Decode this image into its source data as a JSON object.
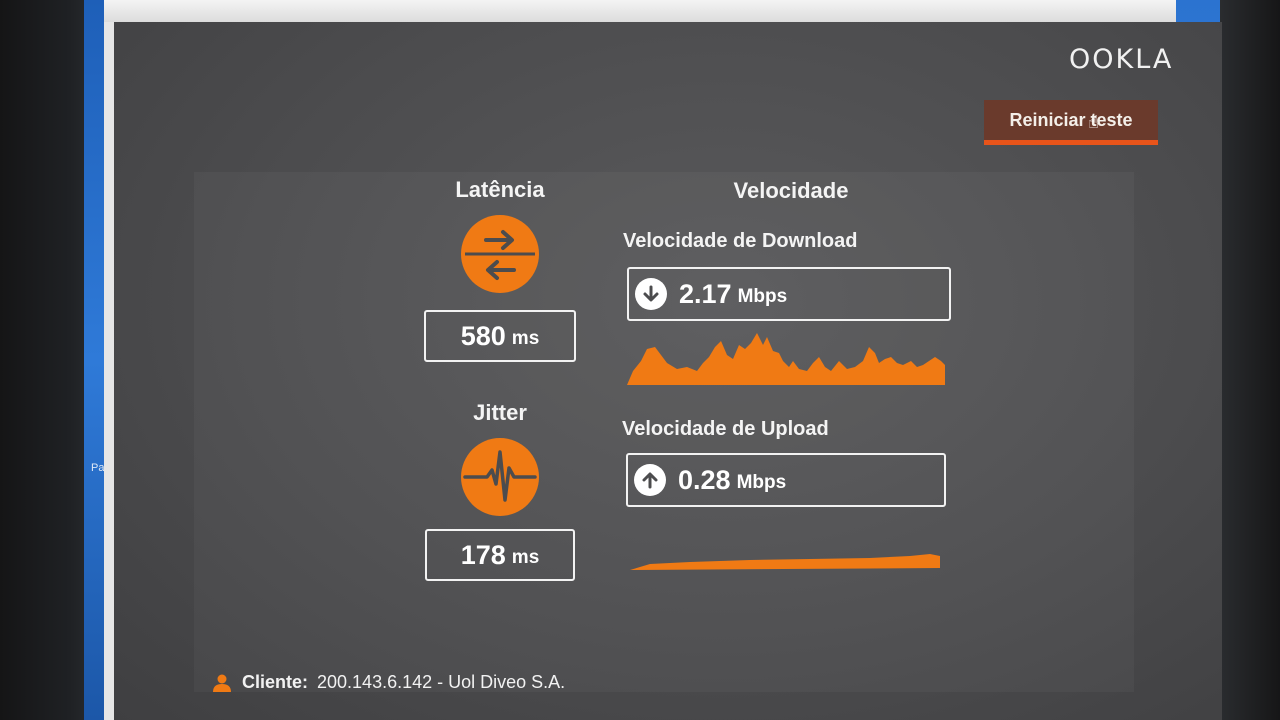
{
  "brand": {
    "logo_text": "OOKLA"
  },
  "desktop": {
    "side_label": "Pa"
  },
  "header": {
    "restart_label": "Reiniciar teste"
  },
  "latency": {
    "title": "Latência",
    "value": "580",
    "unit": "ms",
    "icon": "latency-arrows-icon"
  },
  "jitter": {
    "title": "Jitter",
    "value": "178",
    "unit": "ms",
    "icon": "pulse-icon"
  },
  "speed": {
    "title": "Velocidade",
    "download": {
      "label": "Velocidade de Download",
      "value": "2.17",
      "unit": "Mbps",
      "icon": "arrow-down-icon"
    },
    "upload": {
      "label": "Velocidade de Upload",
      "value": "0.28",
      "unit": "Mbps",
      "icon": "arrow-up-icon"
    }
  },
  "client": {
    "label": "Cliente:",
    "value": "200.143.6.142 - Uol Diveo S.A.",
    "icon": "person-icon"
  },
  "colors": {
    "accent": "#f07a14",
    "panel": "#4c4c4e",
    "button": "#6a3a2c",
    "button_underline": "#e8541a"
  }
}
